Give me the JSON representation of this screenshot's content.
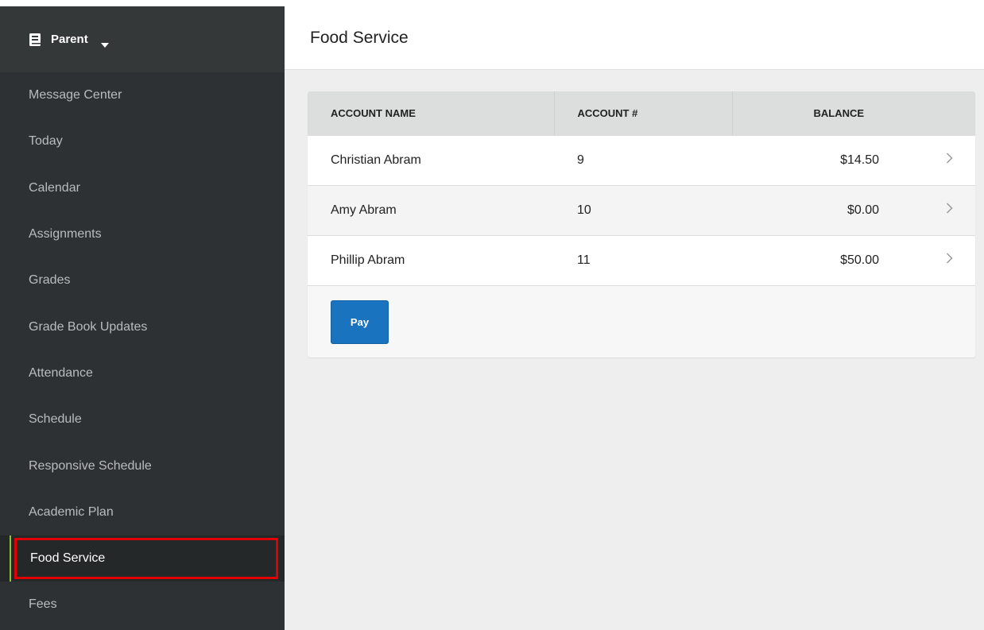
{
  "sidebar": {
    "role_label": "Parent",
    "items": [
      {
        "label": "Message Center"
      },
      {
        "label": "Today"
      },
      {
        "label": "Calendar"
      },
      {
        "label": "Assignments"
      },
      {
        "label": "Grades"
      },
      {
        "label": "Grade Book Updates"
      },
      {
        "label": "Attendance"
      },
      {
        "label": "Schedule"
      },
      {
        "label": "Responsive Schedule"
      },
      {
        "label": "Academic Plan"
      },
      {
        "label": "Food Service",
        "active": true
      },
      {
        "label": "Fees"
      }
    ]
  },
  "page": {
    "title": "Food Service"
  },
  "table": {
    "headers": [
      "ACCOUNT NAME",
      "ACCOUNT #",
      "BALANCE"
    ],
    "rows": [
      {
        "name": "Christian Abram",
        "account": "9",
        "balance": "$14.50"
      },
      {
        "name": "Amy Abram",
        "account": "10",
        "balance": "$0.00"
      },
      {
        "name": "Phillip Abram",
        "account": "11",
        "balance": "$50.00"
      }
    ]
  },
  "actions": {
    "pay_label": "Pay"
  },
  "colors": {
    "sidebar_bg": "#2e3133",
    "active_accent": "#8dc63f",
    "highlight_border": "#e00000",
    "pay_button": "#1a73be"
  },
  "icons": {
    "role": "book-icon",
    "role_dropdown": "caret-down-icon",
    "row_action": "chevron-right-icon"
  }
}
